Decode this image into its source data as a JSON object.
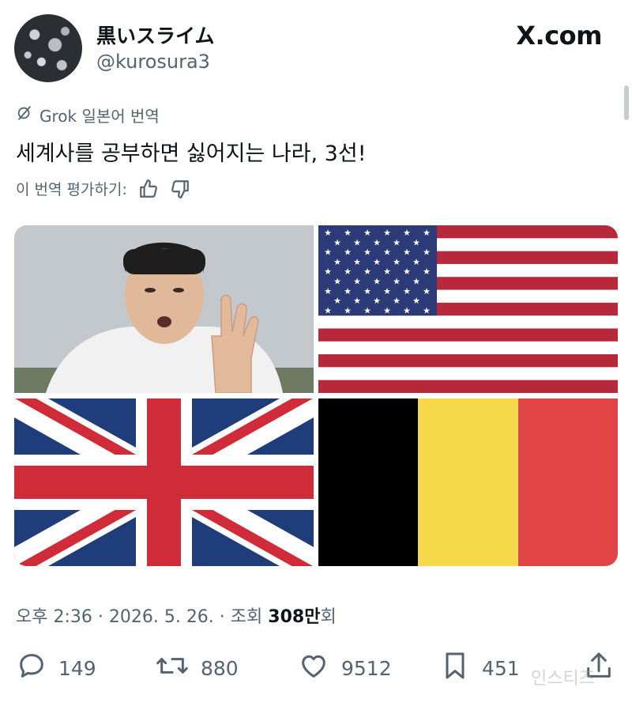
{
  "header": {
    "display_name": "黒いスライム",
    "handle": "@kurosura3",
    "brand": "X.com"
  },
  "translation": {
    "label": "Grok 일본어 번역",
    "rate_label": "이 번역 평가하기:"
  },
  "tweet": {
    "text": "세계사를 공부하면 싫어지는 나라, 3선!"
  },
  "media": {
    "flags": [
      "united-states-flag",
      "united-kingdom-flag",
      "belgium-flag"
    ],
    "belgium_colors": [
      "#000000",
      "#f5d94a",
      "#e04444"
    ],
    "uk_colors": {
      "blue": "#1f3d7a",
      "red": "#cf2b39",
      "white": "#ffffff"
    },
    "us_colors": {
      "blue": "#2c3a78",
      "red": "#b8283b",
      "white": "#ffffff"
    }
  },
  "meta": {
    "prefix": "오후 2:36 · 2026. 5. 26. · 조회 ",
    "views": "308만",
    "suffix": "회"
  },
  "actions": {
    "replies": "149",
    "reposts": "880",
    "likes": "9512",
    "bookmarks": "451"
  },
  "watermark": "인스티즈",
  "icons": {
    "reply": "reply-icon",
    "repost": "repost-icon",
    "like": "heart-icon",
    "bookmark": "bookmark-icon",
    "share": "share-icon",
    "grok": "grok-icon",
    "thumbs_up": "thumbs-up-icon",
    "thumbs_down": "thumbs-down-icon"
  }
}
